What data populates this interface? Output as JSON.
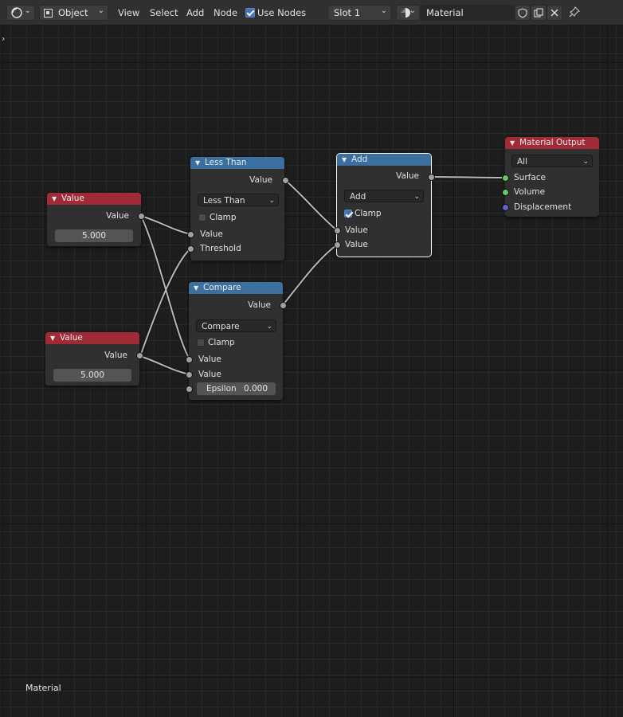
{
  "header": {
    "editor_type_icon": "node-editor-icon",
    "mode": "Object",
    "menus": [
      "View",
      "Select",
      "Add",
      "Node"
    ],
    "use_nodes_label": "Use Nodes",
    "use_nodes_checked": true,
    "slot": "Slot 1",
    "material_icon": "material-sphere-icon",
    "material_name": "Material",
    "icons": [
      "fake-user-shield-icon",
      "duplicate-icon",
      "close-icon",
      "pin-icon"
    ]
  },
  "sidebar_toggle": "›",
  "nodes": {
    "value1": {
      "title": "Value",
      "output": "Value",
      "value": "5.000"
    },
    "value2": {
      "title": "Value",
      "output": "Value",
      "value": "5.000"
    },
    "less_than": {
      "title": "Less Than",
      "output": "Value",
      "operation": "Less Than",
      "clamp_label": "Clamp",
      "clamp_checked": false,
      "inputs": [
        "Value",
        "Threshold"
      ]
    },
    "compare": {
      "title": "Compare",
      "output": "Value",
      "operation": "Compare",
      "clamp_label": "Clamp",
      "clamp_checked": false,
      "inputs": [
        "Value",
        "Value"
      ],
      "epsilon_label": "Epsilon",
      "epsilon_value": "0.000"
    },
    "add": {
      "title": "Add",
      "output": "Value",
      "operation": "Add",
      "clamp_label": "Clamp",
      "clamp_checked": true,
      "inputs": [
        "Value",
        "Value"
      ]
    },
    "material_output": {
      "title": "Material Output",
      "target": "All",
      "inputs": [
        "Surface",
        "Volume",
        "Displacement"
      ]
    }
  },
  "footer_label": "Material",
  "colors": {
    "header_red": "#a02a36",
    "header_blue": "#3b6f9f",
    "socket_grey": "#a1a1a1",
    "socket_green": "#63c763",
    "socket_purple": "#6363c7"
  }
}
